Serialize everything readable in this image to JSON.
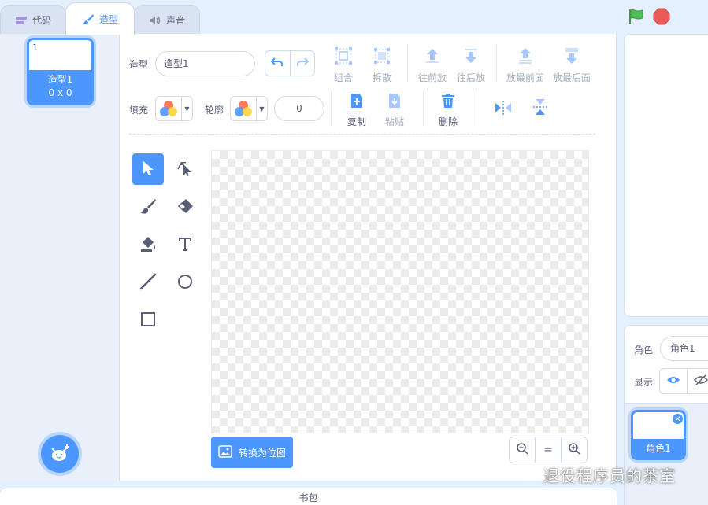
{
  "tabs": [
    {
      "label": "代码",
      "icon": "code-icon"
    },
    {
      "label": "造型",
      "icon": "brush-icon"
    },
    {
      "label": "声音",
      "icon": "sound-icon"
    }
  ],
  "costumes": [
    {
      "number": "1",
      "name": "造型1",
      "size": "0 x 0"
    }
  ],
  "toolbar": {
    "costume_label": "造型",
    "costume_name": "造型1",
    "group": "组合",
    "ungroup": "拆散",
    "forward": "往前放",
    "backward": "往后放",
    "front": "放最前面",
    "back": "放最后面",
    "fill_label": "填充",
    "outline_label": "轮廓",
    "outline_width": "0",
    "copy": "复制",
    "paste": "粘贴",
    "delete": "删除"
  },
  "tools": [
    "select",
    "reshape",
    "brush",
    "eraser",
    "fill",
    "text",
    "line",
    "circle",
    "rectangle"
  ],
  "canvas": {
    "convert_button": "转换为位图",
    "zoom_reset": "="
  },
  "backpack": {
    "label": "书包"
  },
  "sprite_info": {
    "sprite_label": "角色",
    "sprite_name": "角色1",
    "show_label": "显示"
  },
  "sprites": [
    {
      "name": "角色1"
    }
  ],
  "watermark": "退役程序员的茶室",
  "colors": {
    "accent": "#4c97ff",
    "flag": "#4cbf56",
    "stop": "#ec5959",
    "text": "#575e75",
    "disabled": "#a6b0c0"
  }
}
